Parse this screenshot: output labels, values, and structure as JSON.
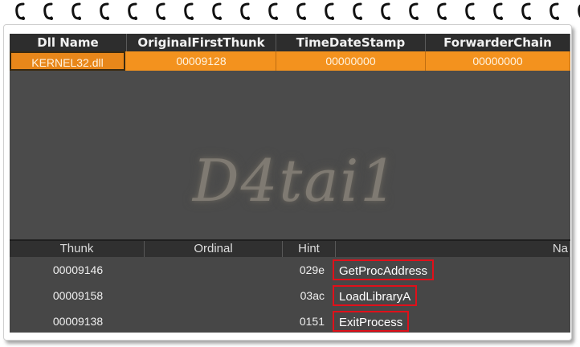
{
  "watermark": "D4tai1",
  "dll_table": {
    "headers": [
      "Dll Name",
      "OriginalFirstThunk",
      "TimeDateStamp",
      "ForwarderChain"
    ],
    "rows": [
      [
        "KERNEL32.dll",
        "00009128",
        "00000000",
        "00000000"
      ]
    ]
  },
  "import_table": {
    "headers": [
      "Thunk",
      "Ordinal",
      "Hint",
      "Na"
    ],
    "rows": [
      {
        "thunk": "00009146",
        "ordinal": "",
        "hint": "029e",
        "name": "GetProcAddress"
      },
      {
        "thunk": "00009158",
        "ordinal": "",
        "hint": "03ac",
        "name": "LoadLibraryA"
      },
      {
        "thunk": "00009138",
        "ordinal": "",
        "hint": "0151",
        "name": "ExitProcess"
      }
    ]
  },
  "colors": {
    "selected_row": "#f3921e",
    "highlight_box": "#e0101a"
  }
}
